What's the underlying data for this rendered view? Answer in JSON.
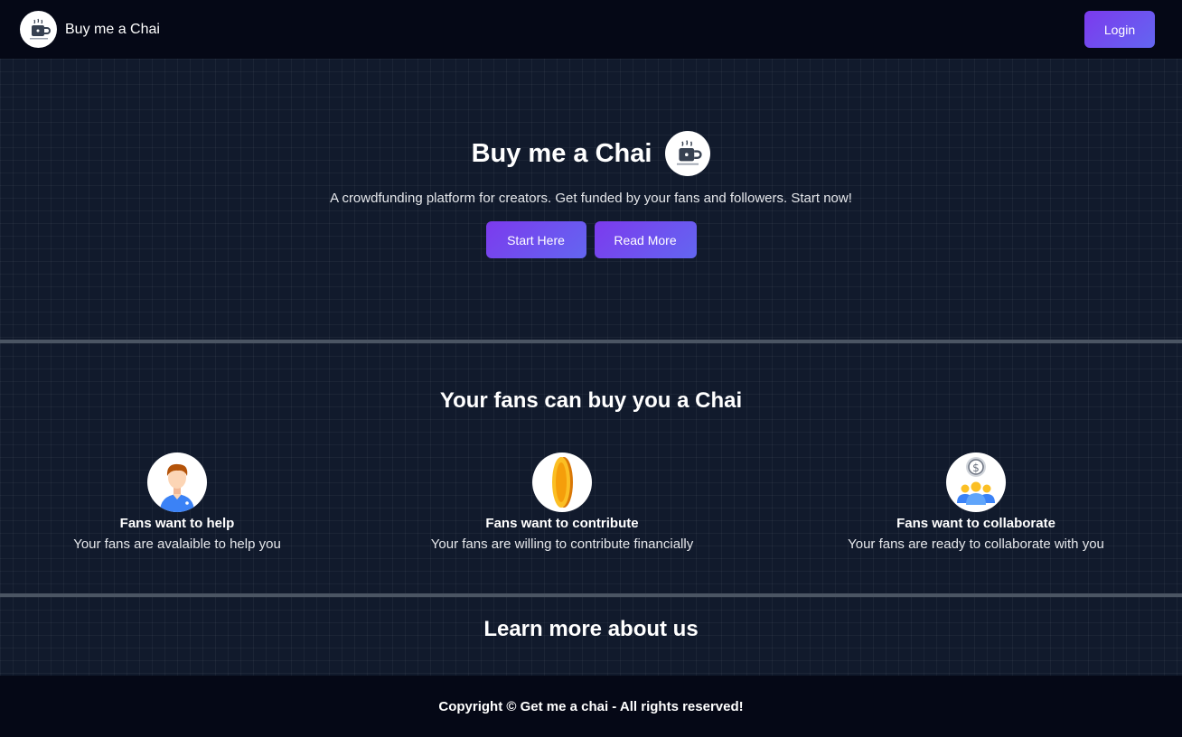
{
  "nav": {
    "brand": "Buy me a Chai",
    "brand_icon": "chai-cup-icon",
    "login_label": "Login"
  },
  "hero": {
    "title": "Buy me a Chai",
    "subtitle": "A crowdfunding platform for creators. Get funded by your fans and followers. Start now!",
    "start_label": "Start Here",
    "read_label": "Read More"
  },
  "fans": {
    "title": "Your fans can buy you a Chai",
    "items": [
      {
        "icon": "man-avatar-icon",
        "title": "Fans want to help",
        "desc": "Your fans are avalaible to help you"
      },
      {
        "icon": "gold-coin-icon",
        "title": "Fans want to contribute",
        "desc": "Your fans are willing to contribute financially"
      },
      {
        "icon": "group-money-icon",
        "title": "Fans want to collaborate",
        "desc": "Your fans are ready to collaborate with you"
      }
    ]
  },
  "learn": {
    "title": "Learn more about us"
  },
  "footer": {
    "copyright": "Copyright © Get me a chai - All rights reserved!"
  },
  "colors": {
    "accent": "#7c3aed",
    "accent_end": "#6366f1",
    "nav_bg": "#050816",
    "page_bg": "#111a2c"
  }
}
